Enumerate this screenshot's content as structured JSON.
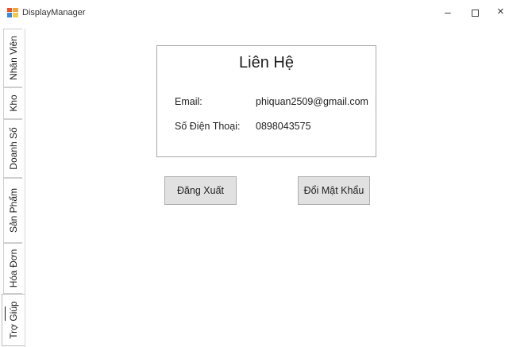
{
  "window": {
    "title": "DisplayManager",
    "controls": {
      "minimize": "–",
      "close": "×"
    }
  },
  "tabs": [
    {
      "label": "Nhân Viên",
      "active": false
    },
    {
      "label": "Kho",
      "active": false
    },
    {
      "label": "Doanh Số",
      "active": false
    },
    {
      "label": "Sản Phẩm",
      "active": false
    },
    {
      "label": "Hóa Đơn",
      "active": false
    },
    {
      "label": "Trợ Giúp",
      "active": true
    }
  ],
  "contact": {
    "title": "Liên Hệ",
    "email_label": "Email:",
    "email_value": "phiquan2509@gmail.com",
    "phone_label": "Số Điện Thoại:",
    "phone_value": "0898043575"
  },
  "actions": {
    "logout_label": "Đăng Xuất",
    "change_password_label": "Đổi Mật Khẩu"
  }
}
